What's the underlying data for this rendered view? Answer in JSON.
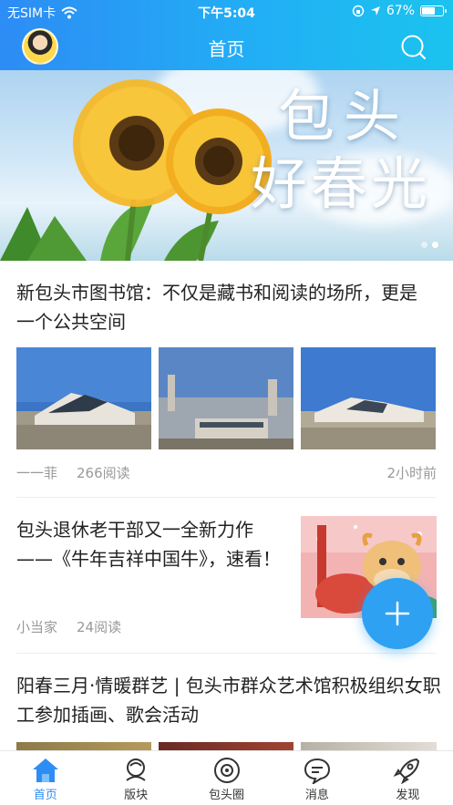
{
  "status_bar": {
    "carrier": "无SIM卡",
    "time": "下午5:04",
    "battery_percent": "67%",
    "battery_level": 0.67
  },
  "nav": {
    "title": "首页"
  },
  "banner": {
    "line1": "包头",
    "line2": "好春光",
    "page_count": 2,
    "active_page": 2
  },
  "articles": [
    {
      "title": "新包头市图书馆：不仅是藏书和阅读的场所，更是一个公共空间",
      "author": "一一菲",
      "reads": "266阅读",
      "time": "2小时前"
    },
    {
      "title": "包头退休老干部又一全新力作——《牛年吉祥中国牛》，速看！",
      "author": "小当家",
      "reads": "24阅读"
    },
    {
      "title": "阳春三月·情暖群艺 | 包头市群众艺术馆积极组织女职工参加插画、歌会活动"
    }
  ],
  "tabs": [
    {
      "label": "首页",
      "icon": "home-icon"
    },
    {
      "label": "版块",
      "icon": "board-icon"
    },
    {
      "label": "包头圈",
      "icon": "circle-icon"
    },
    {
      "label": "消息",
      "icon": "message-icon"
    },
    {
      "label": "发现",
      "icon": "rocket-icon"
    }
  ],
  "colors": {
    "accent": "#2e8df5",
    "header_start": "#2d8cf5",
    "header_end": "#1bc3ef",
    "fab": "#2ea1f2"
  }
}
